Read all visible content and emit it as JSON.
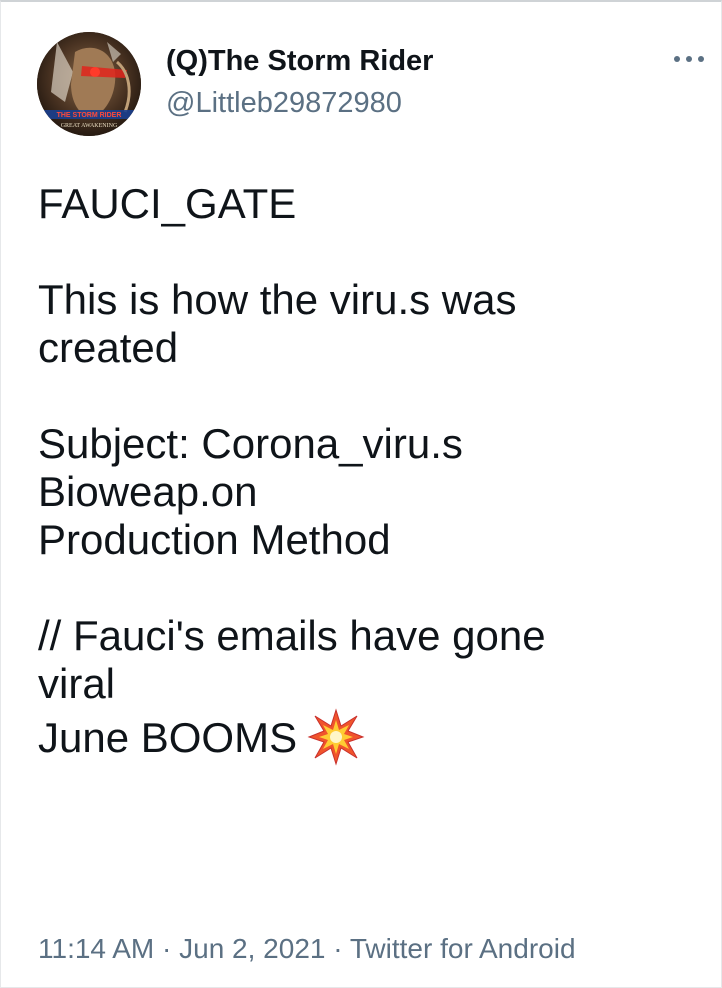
{
  "author": {
    "display_name": "(Q)The Storm Rider",
    "handle": "@Littleb29872980",
    "avatar_text": "THE STORM RIDER · GREAT AWAKENING",
    "avatar_icon": "profile-avatar"
  },
  "more_icon": "more-options-icon",
  "tweet": {
    "lines": [
      "FAUCI_GATE",
      "",
      "This is how the viru.s was",
      "created",
      "",
      "Subject: Corona_viru.s",
      "Bioweap.on",
      "Production Method",
      "",
      "// Fauci's emails have gone",
      "viral",
      "June BOOMS"
    ],
    "emoji_name": "collision-emoji"
  },
  "meta": {
    "time": "11:14 AM",
    "separator": " · ",
    "date": "Jun 2, 2021",
    "source": "Twitter for Android"
  },
  "colors": {
    "text": "#0f1419",
    "secondary": "#5b7083",
    "avatar_accent": "#e0241c"
  }
}
